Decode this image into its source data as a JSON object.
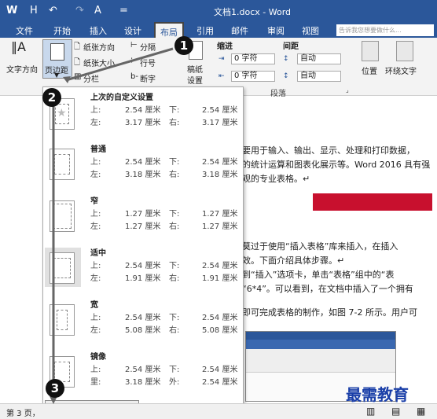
{
  "titlebar": {
    "title": "文档1.docx - Word",
    "qa_word": "W",
    "qa_save": "H",
    "qa_undo": "↶",
    "qa_redo": "↷",
    "qa_font": "A",
    "qa_more": "="
  },
  "tabs": [
    "文件",
    "开始",
    "插入",
    "设计",
    "布局",
    "引用",
    "邮件",
    "审阅",
    "视图"
  ],
  "tell_me_placeholder": "告诉我您想要做什么...",
  "ribbon": {
    "text_direction": "文字方向",
    "margins": "页边距",
    "orientation": "纸张方向",
    "size": "纸张大小",
    "columns": "分栏",
    "breaks": "分隔",
    "line_numbers": "行号",
    "hyphenation": "断字",
    "draft_paper": "稿纸",
    "draft_paper_2": "设置",
    "indent_label": "缩进",
    "spacing_label": "间距",
    "indent_left": "0 字符",
    "indent_right": "0 字符",
    "spacing_before": "自动",
    "spacing_after": "自动",
    "paragraph_group": "段落",
    "position": "位置",
    "wrap_text": "环绕文字"
  },
  "presets": [
    {
      "name": "上次的自定义设置",
      "r1": [
        "上:",
        "2.54 厘米",
        "下:",
        "2.54 厘米"
      ],
      "r2": [
        "左:",
        "3.17 厘米",
        "右:",
        "3.17 厘米"
      ]
    },
    {
      "name": "普通",
      "r1": [
        "上:",
        "2.54 厘米",
        "下:",
        "2.54 厘米"
      ],
      "r2": [
        "左:",
        "3.18 厘米",
        "右:",
        "3.18 厘米"
      ]
    },
    {
      "name": "窄",
      "r1": [
        "上:",
        "1.27 厘米",
        "下:",
        "1.27 厘米"
      ],
      "r2": [
        "左:",
        "1.27 厘米",
        "右:",
        "1.27 厘米"
      ]
    },
    {
      "name": "适中",
      "r1": [
        "上:",
        "2.54 厘米",
        "下:",
        "2.54 厘米"
      ],
      "r2": [
        "左:",
        "1.91 厘米",
        "右:",
        "1.91 厘米"
      ]
    },
    {
      "name": "宽",
      "r1": [
        "上:",
        "2.54 厘米",
        "下:",
        "2.54 厘米"
      ],
      "r2": [
        "左:",
        "5.08 厘米",
        "右:",
        "5.08 厘米"
      ]
    },
    {
      "name": "镜像",
      "r1": [
        "上:",
        "2.54 厘米",
        "下:",
        "2.54 厘米"
      ],
      "r2": [
        "里:",
        "3.18 厘米",
        "外:",
        "2.54 厘米"
      ]
    }
  ],
  "custom_margins": "自定义边距(A)...",
  "document": {
    "line1": "要用于输入、输出、显示、处理和打印数据，",
    "line2": "的统计运算和图表化展示等。Word 2016 具有强",
    "line3": "观的专业表格。↵",
    "line4": "莫过于使用“插入表格”库来插入，在插入",
    "line5": "效。下面介绍具体步骤。↵",
    "line6": "到“插入”选项卡，单击“表格”组中的“表",
    "line7": "“6*4”。可以看到，在文档中插入了一个拥有",
    "line8": "即可完成表格的制作，如图 7-2 所示。用户可"
  },
  "status": {
    "page": "第 3 页，"
  },
  "callouts": [
    "1",
    "2",
    "3"
  ],
  "watermark": "最需教育",
  "colors": {
    "ribbon_blue": "#2b579a",
    "callout": "#111111",
    "red_banner": "#c8102e"
  }
}
